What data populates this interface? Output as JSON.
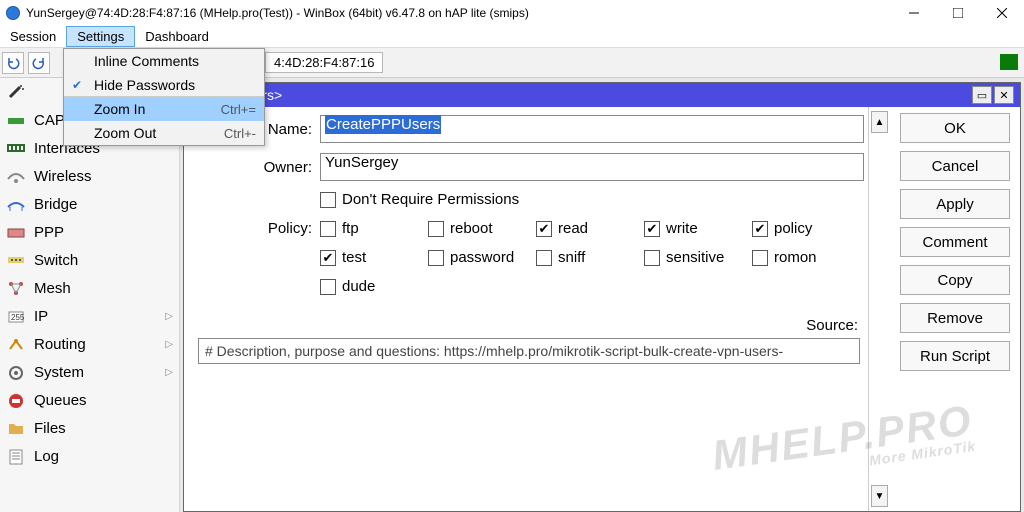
{
  "title": "YunSergey@74:4D:28:F4:87:16 (MHelp.pro(Test)) - WinBox (64bit) v6.47.8 on hAP lite (smips)",
  "menubar": [
    "Session",
    "Settings",
    "Dashboard"
  ],
  "toolbar_mac": "4:4D:28:F4:87:16",
  "dropdown": {
    "items": [
      {
        "label": "Inline Comments",
        "checked": false,
        "accel": "",
        "hover": false,
        "sep": false
      },
      {
        "label": "Hide Passwords",
        "checked": true,
        "accel": "",
        "hover": false,
        "sep": true
      },
      {
        "label": "Zoom In",
        "checked": false,
        "accel": "Ctrl+=",
        "hover": true,
        "sep": false
      },
      {
        "label": "Zoom Out",
        "checked": false,
        "accel": "Ctrl+-",
        "hover": false,
        "sep": false
      }
    ]
  },
  "sidebar": [
    {
      "label": "CAPsMAN",
      "expand": false,
      "icon": "caps"
    },
    {
      "label": "Interfaces",
      "expand": false,
      "icon": "iface"
    },
    {
      "label": "Wireless",
      "expand": false,
      "icon": "wifi"
    },
    {
      "label": "Bridge",
      "expand": false,
      "icon": "bridge"
    },
    {
      "label": "PPP",
      "expand": false,
      "icon": "ppp"
    },
    {
      "label": "Switch",
      "expand": false,
      "icon": "switch"
    },
    {
      "label": "Mesh",
      "expand": false,
      "icon": "mesh"
    },
    {
      "label": "IP",
      "expand": true,
      "icon": "ip"
    },
    {
      "label": "Routing",
      "expand": true,
      "icon": "routing"
    },
    {
      "label": "System",
      "expand": true,
      "icon": "system"
    },
    {
      "label": "Queues",
      "expand": false,
      "icon": "queues"
    },
    {
      "label": "Files",
      "expand": false,
      "icon": "files"
    },
    {
      "label": "Log",
      "expand": false,
      "icon": "log"
    }
  ],
  "window": {
    "title": "atePPPUsers>",
    "name_label": "Name:",
    "name_value": "CreatePPPUsers",
    "owner_label": "Owner:",
    "owner_value": "YunSergey",
    "dont_require": "Don't Require Permissions",
    "policy_label": "Policy:",
    "policies": [
      {
        "label": "ftp",
        "checked": false
      },
      {
        "label": "reboot",
        "checked": false
      },
      {
        "label": "read",
        "checked": true
      },
      {
        "label": "write",
        "checked": true
      },
      {
        "label": "policy",
        "checked": true
      },
      {
        "label": "test",
        "checked": true
      },
      {
        "label": "password",
        "checked": false
      },
      {
        "label": "sniff",
        "checked": false
      },
      {
        "label": "sensitive",
        "checked": false
      },
      {
        "label": "romon",
        "checked": false
      },
      {
        "label": "dude",
        "checked": false
      }
    ],
    "source_label": "Source:",
    "source_text": "# Description, purpose and questions: https://mhelp.pro/mikrotik-script-bulk-create-vpn-users-",
    "buttons": [
      "OK",
      "Cancel",
      "Apply",
      "Comment",
      "Copy",
      "Remove",
      "Run Script"
    ]
  },
  "watermark": "MHELP.PRO",
  "watermark_sub": "More MikroTik"
}
